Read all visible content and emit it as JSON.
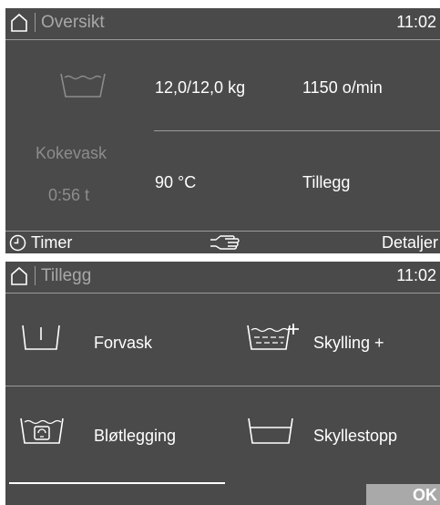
{
  "overview": {
    "title": "Oversikt",
    "time": "11:02",
    "program_name": "Kokevask",
    "remaining_time": "0:56 t",
    "load": "12,0/12,0  kg",
    "spin_speed": "1150 o/min",
    "temperature": "90 °C",
    "extras_label": "Tillegg",
    "footer": {
      "timer_label": "Timer",
      "details_label": "Detaljer"
    }
  },
  "extras": {
    "title": "Tillegg",
    "time": "11:02",
    "options": [
      {
        "label": "Forvask",
        "icon": "prewash-icon"
      },
      {
        "label": "Skylling +",
        "icon": "extra-rinse-icon"
      },
      {
        "label": "Bløtlegging",
        "icon": "soak-icon"
      },
      {
        "label": "Skyllestopp",
        "icon": "rinse-hold-icon"
      }
    ],
    "ok_label": "OK"
  },
  "colors": {
    "screen_bg": "#4a4a4a",
    "text": "#ffffff",
    "dim_text": "#a8a8a8",
    "ok_button": "#a9a9a9"
  }
}
